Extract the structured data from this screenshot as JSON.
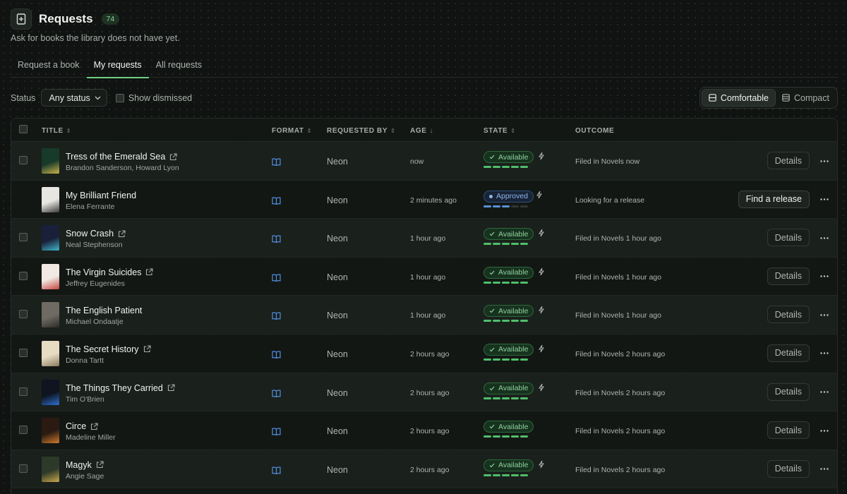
{
  "header": {
    "title": "Requests",
    "count": "74",
    "subtitle": "Ask for books the library does not have yet."
  },
  "tabs": [
    {
      "label": "Request a book",
      "active": false
    },
    {
      "label": "My requests",
      "active": true
    },
    {
      "label": "All requests",
      "active": false
    }
  ],
  "filters": {
    "status_label": "Status",
    "status_value": "Any status",
    "show_dismissed_label": "Show dismissed",
    "show_dismissed_checked": false
  },
  "density": {
    "comfortable_label": "Comfortable",
    "compact_label": "Compact",
    "selected": "Comfortable"
  },
  "table": {
    "columns": {
      "title": "TITLE",
      "format": "FORMAT",
      "requested_by": "REQUESTED BY",
      "age": "AGE",
      "state": "STATE",
      "outcome": "OUTCOME"
    },
    "rows": [
      {
        "title": "Tress of the Emerald Sea",
        "author": "Brandon Sanderson, Howard Lyon",
        "external_link": true,
        "format_icon": "book-icon",
        "requested_by": "Neon",
        "age": "now",
        "state": "Available",
        "state_kind": "available",
        "progress_done": 5,
        "bolt": true,
        "outcome": "Filed in Novels now",
        "action": "Details",
        "checkbox": true,
        "cover_colors": [
          "#173a2a",
          "#c9b24a"
        ]
      },
      {
        "title": "My Brilliant Friend",
        "author": "Elena Ferrante",
        "external_link": false,
        "format_icon": "book-icon",
        "requested_by": "Neon",
        "age": "2 minutes ago",
        "state": "Approved",
        "state_kind": "approved",
        "progress_done": 3,
        "bolt": true,
        "outcome": "Looking for a release",
        "action": "Find a release",
        "checkbox": false,
        "cover_colors": [
          "#e8e6e0",
          "#3b3b3b"
        ]
      },
      {
        "title": "Snow Crash",
        "author": "Neal Stephenson",
        "external_link": true,
        "format_icon": "book-icon",
        "requested_by": "Neon",
        "age": "1 hour ago",
        "state": "Available",
        "state_kind": "available",
        "progress_done": 5,
        "bolt": true,
        "outcome": "Filed in Novels 1 hour ago",
        "action": "Details",
        "checkbox": true,
        "cover_colors": [
          "#1a1f3a",
          "#3fb6c9"
        ]
      },
      {
        "title": "The Virgin Suicides",
        "author": "Jeffrey Eugenides",
        "external_link": true,
        "format_icon": "book-icon",
        "requested_by": "Neon",
        "age": "1 hour ago",
        "state": "Available",
        "state_kind": "available",
        "progress_done": 5,
        "bolt": true,
        "outcome": "Filed in Novels 1 hour ago",
        "action": "Details",
        "checkbox": true,
        "cover_colors": [
          "#f1e9e3",
          "#c2463e"
        ]
      },
      {
        "title": "The English Patient",
        "author": "Michael Ondaatje",
        "external_link": false,
        "format_icon": "book-icon",
        "requested_by": "Neon",
        "age": "1 hour ago",
        "state": "Available",
        "state_kind": "available",
        "progress_done": 5,
        "bolt": true,
        "outcome": "Filed in Novels 1 hour ago",
        "action": "Details",
        "checkbox": true,
        "cover_colors": [
          "#6f6b63",
          "#2e2c28"
        ]
      },
      {
        "title": "The Secret History",
        "author": "Donna Tartt",
        "external_link": true,
        "format_icon": "book-icon",
        "requested_by": "Neon",
        "age": "2 hours ago",
        "state": "Available",
        "state_kind": "available",
        "progress_done": 5,
        "bolt": true,
        "outcome": "Filed in Novels 2 hours ago",
        "action": "Details",
        "checkbox": true,
        "cover_colors": [
          "#e6dcc4",
          "#8a7a5a"
        ]
      },
      {
        "title": "The Things They Carried",
        "author": "Tim O'Brien",
        "external_link": true,
        "format_icon": "book-icon",
        "requested_by": "Neon",
        "age": "2 hours ago",
        "state": "Available",
        "state_kind": "available",
        "progress_done": 5,
        "bolt": true,
        "outcome": "Filed in Novels 2 hours ago",
        "action": "Details",
        "checkbox": true,
        "cover_colors": [
          "#0e1420",
          "#2f6fd0"
        ]
      },
      {
        "title": "Circe",
        "author": "Madeline Miller",
        "external_link": true,
        "format_icon": "book-icon",
        "requested_by": "Neon",
        "age": "2 hours ago",
        "state": "Available",
        "state_kind": "available",
        "progress_done": 5,
        "bolt": false,
        "outcome": "Filed in Novels 2 hours ago",
        "action": "Details",
        "checkbox": true,
        "cover_colors": [
          "#2a1a12",
          "#d07a2a"
        ]
      },
      {
        "title": "Magyk",
        "author": "Angie Sage",
        "external_link": true,
        "format_icon": "book-icon",
        "requested_by": "Neon",
        "age": "2 hours ago",
        "state": "Available",
        "state_kind": "available",
        "progress_done": 5,
        "bolt": true,
        "outcome": "Filed in Novels 2 hours ago",
        "action": "Details",
        "checkbox": true,
        "cover_colors": [
          "#2d3a2a",
          "#c9a84a"
        ]
      }
    ]
  },
  "colors": {
    "accent": "#6fcf85",
    "available": "#4fbf6a",
    "approved": "#5a90d8",
    "format_icon": "#4f8fe0"
  }
}
